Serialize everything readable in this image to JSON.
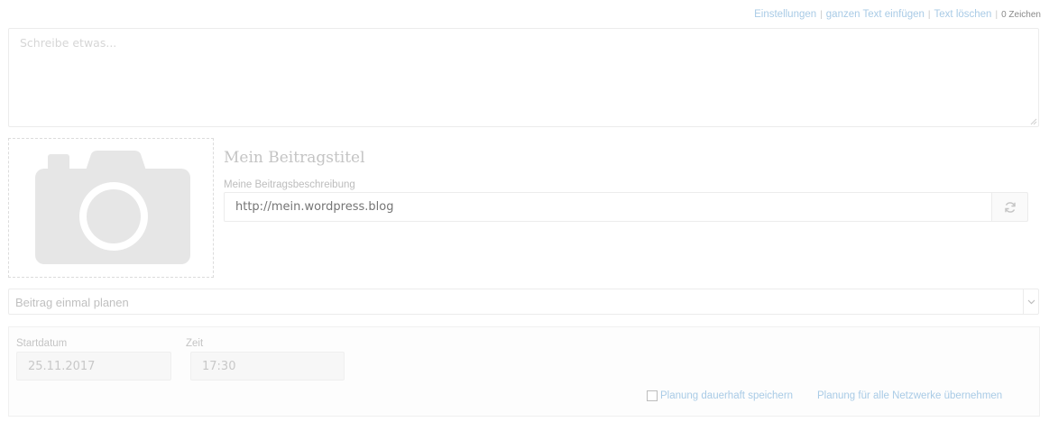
{
  "toolbar": {
    "settings_label": "Einstellungen",
    "insert_full_text_label": "ganzen Text einfügen",
    "clear_text_label": "Text löschen",
    "char_count": "0 Zeichen",
    "separator": "|"
  },
  "composer": {
    "placeholder": "Schreibe etwas..."
  },
  "link_preview": {
    "image_icon": "camera-icon",
    "title": "Mein Beitragstitel",
    "description": "Meine Beitragsbeschreibung",
    "url_placeholder": "http://mein.wordpress.blog",
    "refresh_icon": "refresh-icon"
  },
  "schedule": {
    "mode_selected": "Beitrag einmal planen",
    "start_date_label": "Startdatum",
    "start_date_value": "25.11.2017",
    "time_label": "Zeit",
    "time_value": "17:30",
    "save_permanently_label": "Planung dauerhaft speichern",
    "save_permanently_checked": false,
    "apply_all_networks_label": "Planung für alle Netzwerke übernehmen"
  },
  "colors": {
    "link": "#a9cbe6",
    "border": "#ececec",
    "placeholder_icon": "#e6e6e6"
  }
}
